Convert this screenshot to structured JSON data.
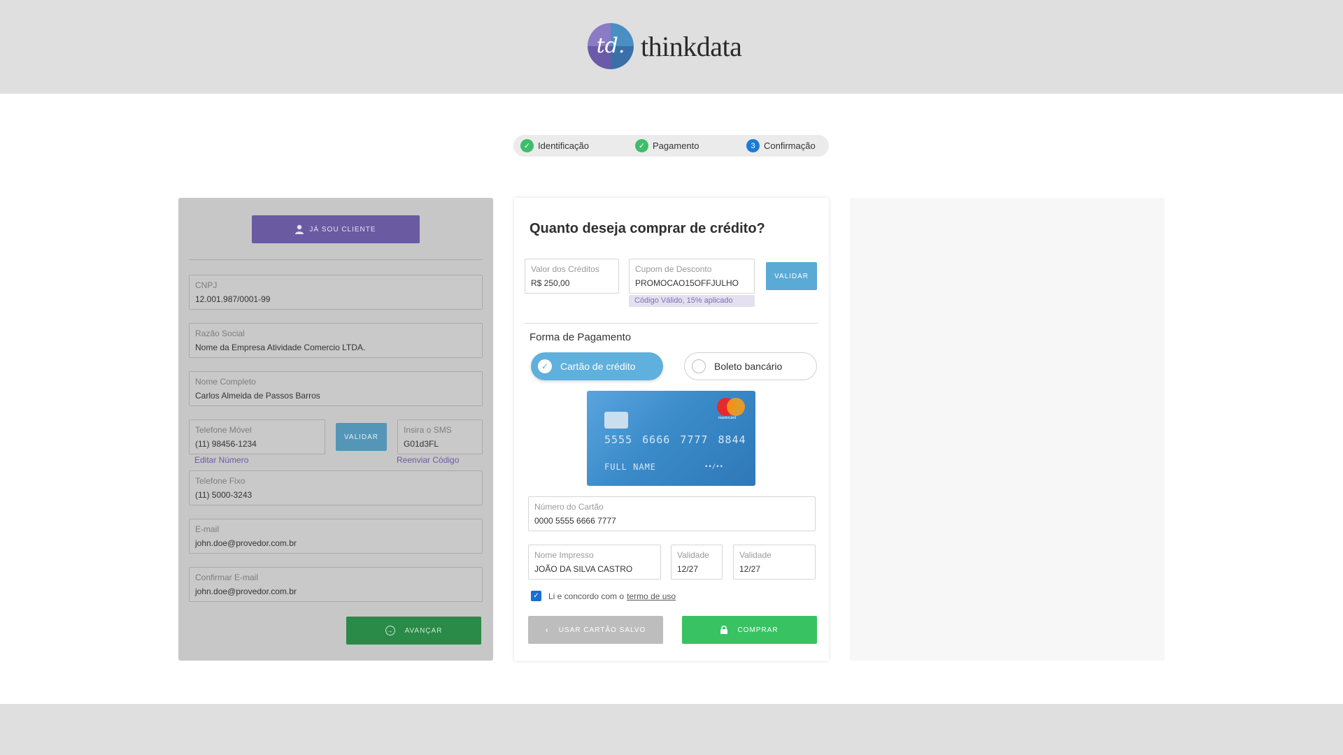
{
  "header": {
    "logo_mark": "td.",
    "logo_word": "thinkdata"
  },
  "stepper": {
    "steps": [
      {
        "label": "Identificação",
        "status": "done"
      },
      {
        "label": "Pagamento",
        "status": "done"
      },
      {
        "label": "Confirmação",
        "status": "current",
        "number": "3"
      }
    ]
  },
  "identification": {
    "client_button": "JÁ SOU CLIENTE",
    "cnpj": {
      "label": "CNPJ",
      "value": "12.001.987/0001-99"
    },
    "razao_social": {
      "label": "Razão Social",
      "value": "Nome da Empresa Atividade Comercio LTDA."
    },
    "nome_completo": {
      "label": "Nome Completo",
      "value": "Carlos Almeida de Passos Barros"
    },
    "telefone_movel": {
      "label": "Telefone Móvel",
      "value": "(11) 98456-1234"
    },
    "validar_button": "VALIDAR",
    "sms": {
      "label": "Insira o SMS",
      "value": "G01d3FL"
    },
    "editar_numero": "Editar Número",
    "reenviar_codigo": "Reenviar Código",
    "telefone_fixo": {
      "label": "Telefone Fixo",
      "value": "(11) 5000-3243"
    },
    "email": {
      "label": "E-mail",
      "value": "john.doe@provedor.com.br"
    },
    "confirmar_email": {
      "label": "Confirmar E-mail",
      "value": "john.doe@provedor.com.br"
    },
    "avancar_button": "AVANÇAR"
  },
  "payment": {
    "title": "Quanto deseja comprar de crédito?",
    "valor_creditos": {
      "label": "Valor dos Créditos",
      "value": "R$ 250,00"
    },
    "cupom": {
      "label": "Cupom de Desconto",
      "value": "PROMOCAO15OFFJULHO"
    },
    "validar_button": "VALIDAR",
    "cupom_message": "Código Válido, 15% aplicado",
    "forma_pagamento": "Forma de Pagamento",
    "option_credit": "Cartão de crédito",
    "option_boleto": "Boleto bancário",
    "selected_option": "credit",
    "card_preview": {
      "number": "5555 6666 7777 8844",
      "name": "FULL NAME",
      "expiry": "••/••",
      "brand": "mastercard"
    },
    "numero_cartao": {
      "label": "Número do Cartão",
      "value": "0000 5555 6666 7777"
    },
    "nome_impresso": {
      "label": "Nome Impresso",
      "value": "JOÃO DA SILVA CASTRO"
    },
    "validade_1": {
      "label": "Validade",
      "value": "12/27"
    },
    "validade_2": {
      "label": "Validade",
      "value": "12/27"
    },
    "terms_text": "Li e concordo com o",
    "terms_link": "termo de uso",
    "terms_checked": true,
    "saved_card_button": "USAR CARTÃO SALVO",
    "buy_button": "COMPRAR"
  },
  "colors": {
    "brand_purple": "#6a5aa2",
    "accent_blue": "#5fb0dc",
    "success_green": "#39c262",
    "step_current": "#1a7bd8"
  }
}
